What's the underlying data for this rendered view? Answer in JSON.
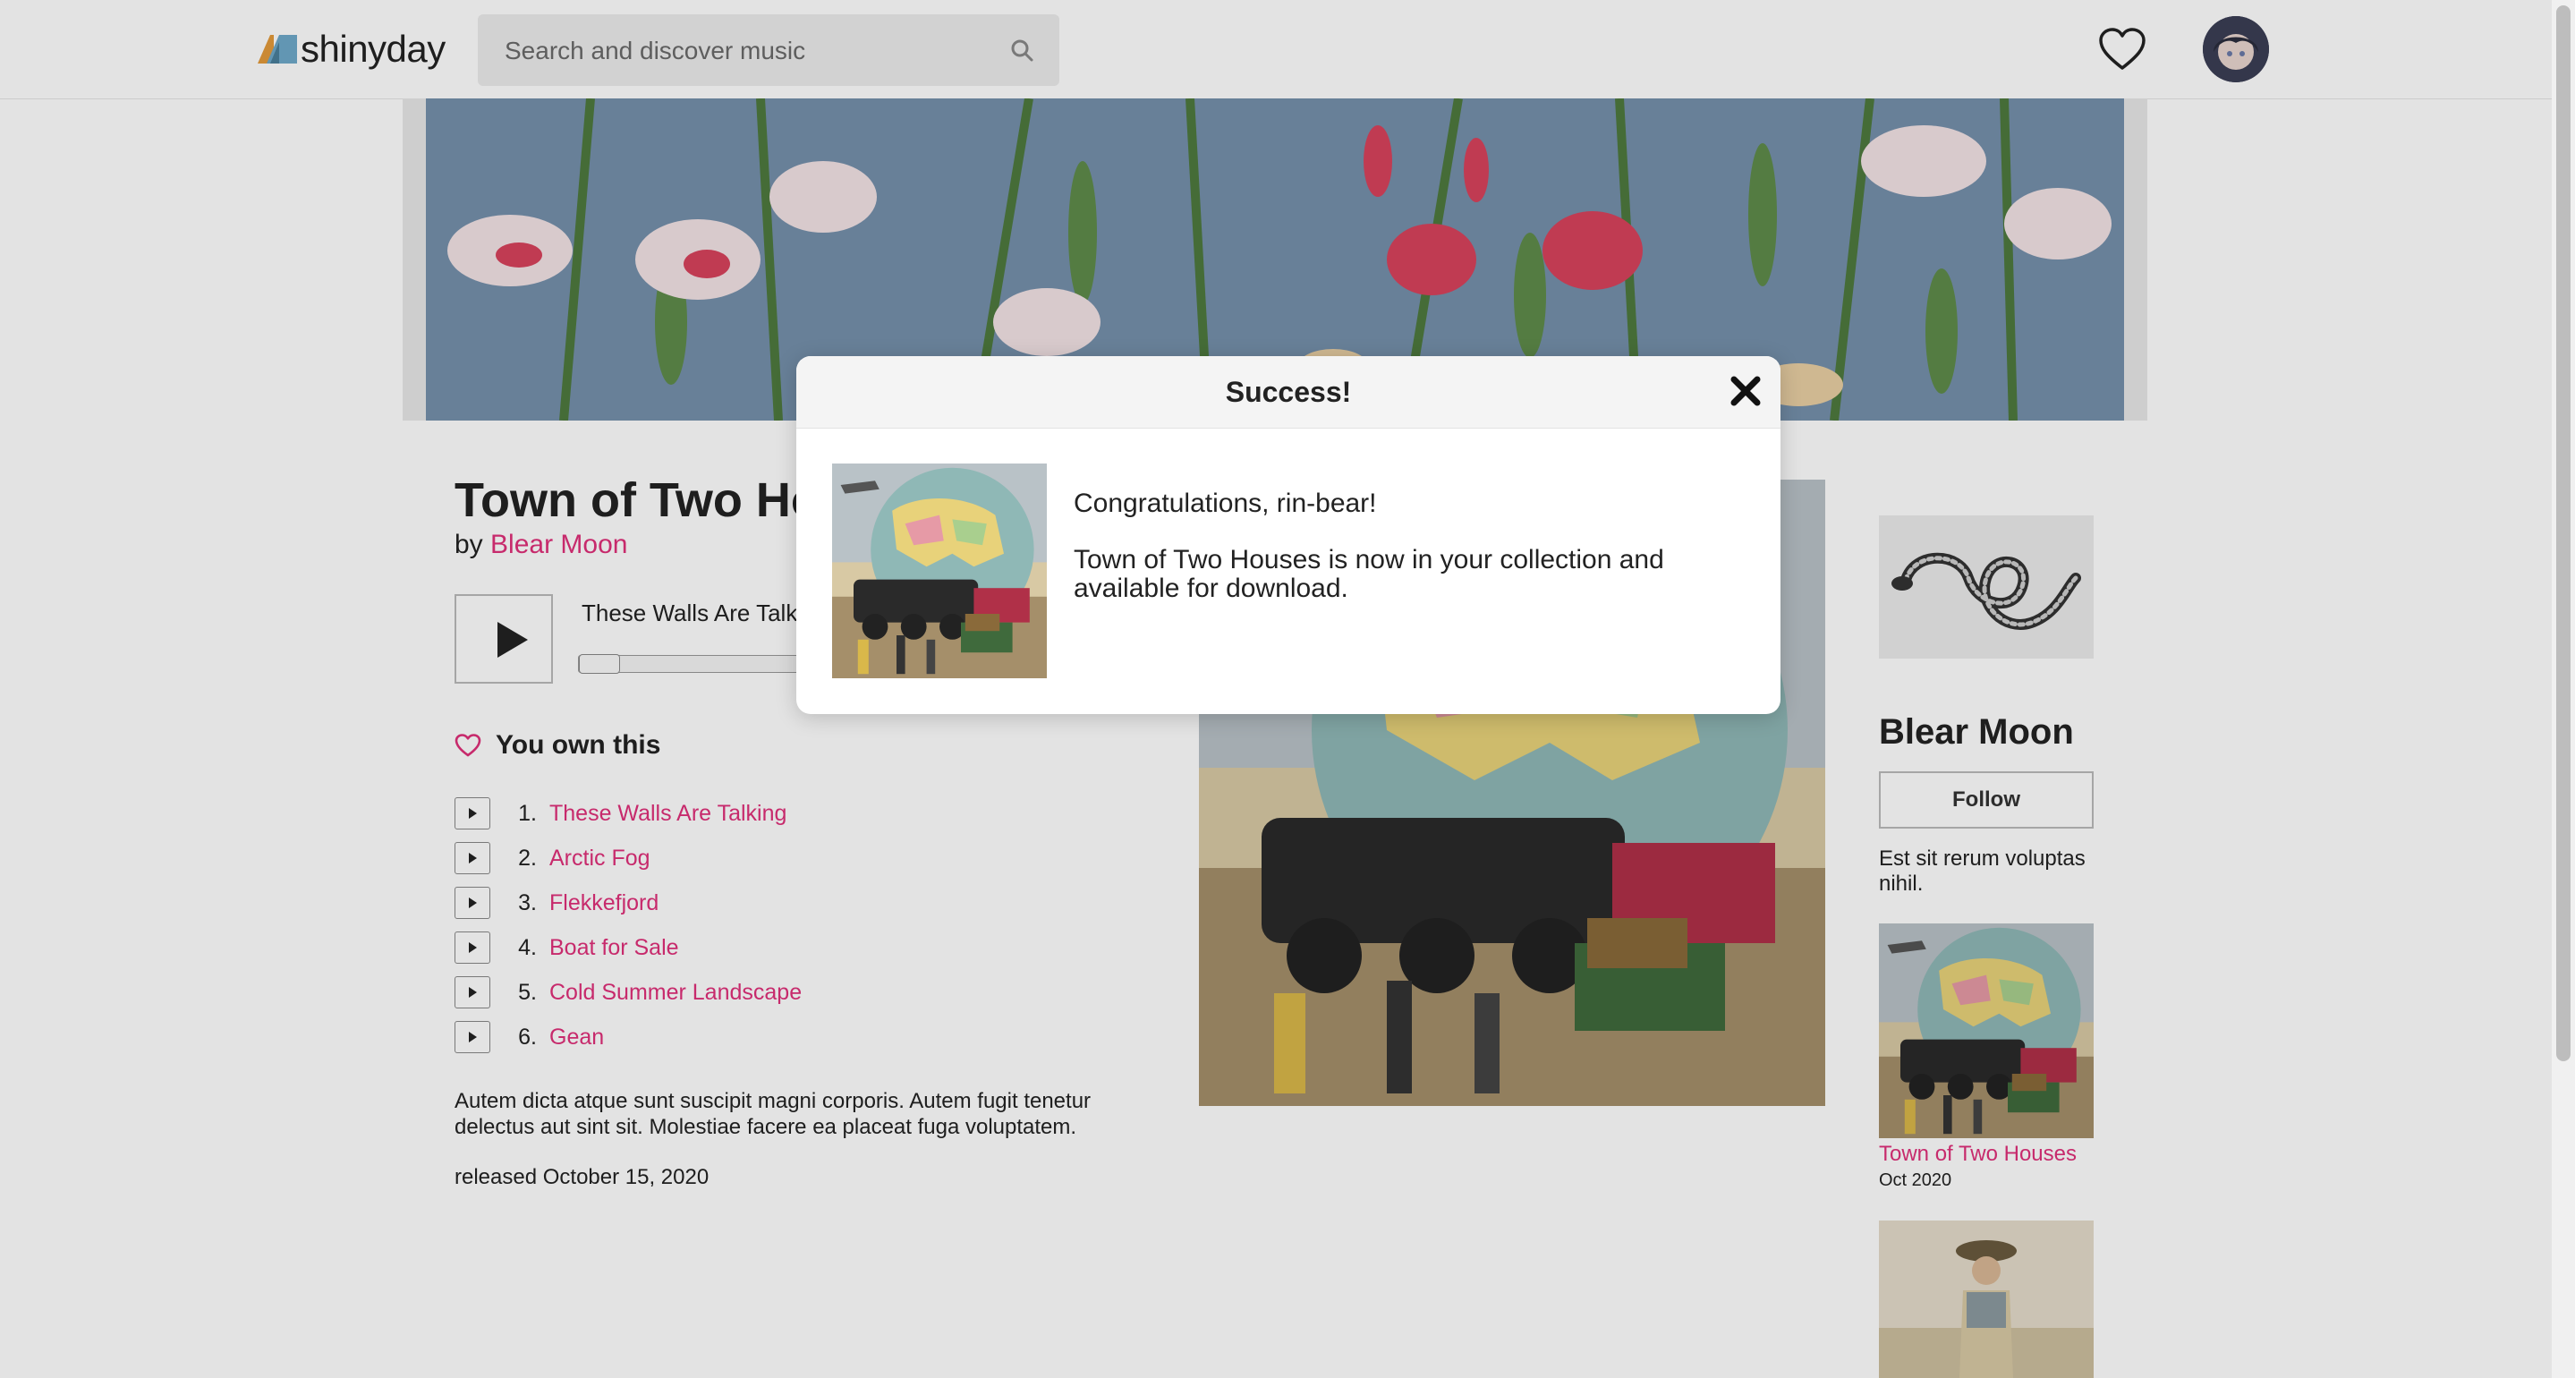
{
  "brand": {
    "name": "shinyday"
  },
  "search": {
    "placeholder": "Search and discover music"
  },
  "album": {
    "title": "Town of Two Houses",
    "by_prefix": "by",
    "artist": "Blear Moon",
    "now_playing": "These Walls Are Talking",
    "progress": 0.0,
    "own_label": "You own this",
    "tracks": [
      {
        "num": "1.",
        "title": "These Walls Are Talking"
      },
      {
        "num": "2.",
        "title": "Arctic Fog"
      },
      {
        "num": "3.",
        "title": "Flekkefjord"
      },
      {
        "num": "4.",
        "title": "Boat for Sale"
      },
      {
        "num": "5.",
        "title": "Cold Summer Landscape"
      },
      {
        "num": "6.",
        "title": "Gean"
      }
    ],
    "description": "Autem dicta atque sunt suscipit magni corporis. Autem fugit tenetur delectus aut sint sit. Molestiae facere ea placeat fuga voluptatem.",
    "released": "released October 15, 2020"
  },
  "artist_panel": {
    "name": "Blear Moon",
    "follow_label": "Follow",
    "bio": "Est sit rerum voluptas nihil.",
    "releases": [
      {
        "title": "Town of Two Houses",
        "date": "Oct 2020"
      }
    ]
  },
  "modal": {
    "title": "Success!",
    "greeting": "Congratulations, rin-bear!",
    "message": "Town of Two Houses is now in your collection and available for download."
  },
  "colors": {
    "accent": "#e0307a",
    "text": "#222222",
    "modal_header": "#f4f4f4"
  }
}
